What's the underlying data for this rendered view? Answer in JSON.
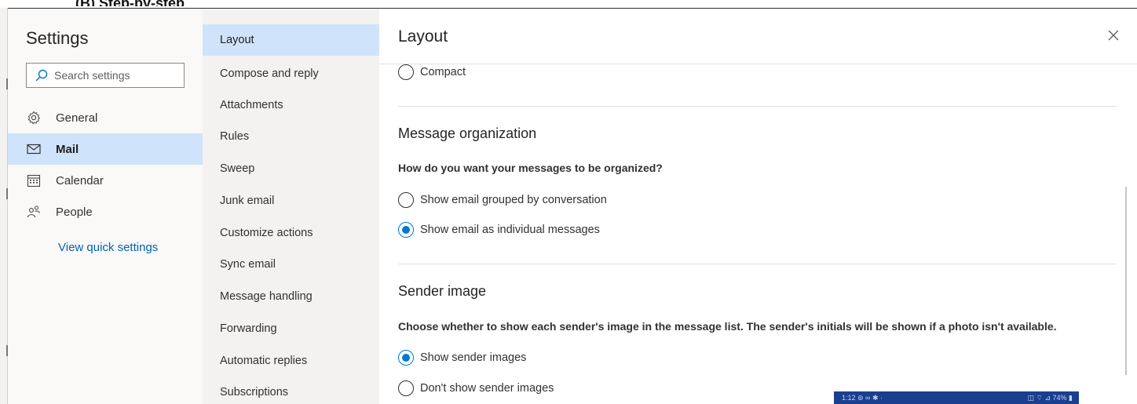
{
  "background": {
    "title_fragment": "(B) Step-by-step"
  },
  "left": {
    "title": "Settings",
    "search_placeholder": "Search settings",
    "categories": [
      {
        "label": "General",
        "icon": "gear-icon"
      },
      {
        "label": "Mail",
        "icon": "mail-icon",
        "active": true
      },
      {
        "label": "Calendar",
        "icon": "calendar-icon"
      },
      {
        "label": "People",
        "icon": "people-icon"
      }
    ],
    "quick_link": "View quick settings"
  },
  "middle": {
    "items": [
      {
        "label": "Layout",
        "active": true
      },
      {
        "label": "Compose and reply"
      },
      {
        "label": "Attachments"
      },
      {
        "label": "Rules"
      },
      {
        "label": "Sweep"
      },
      {
        "label": "Junk email"
      },
      {
        "label": "Customize actions"
      },
      {
        "label": "Sync email"
      },
      {
        "label": "Message handling"
      },
      {
        "label": "Forwarding"
      },
      {
        "label": "Automatic replies"
      },
      {
        "label": "Subscriptions"
      }
    ]
  },
  "right": {
    "title": "Layout",
    "compact_option": {
      "label": "Compact",
      "selected": false
    },
    "message_organization": {
      "heading": "Message organization",
      "question": "How do you want your messages to be organized?",
      "options": [
        {
          "label": "Show email grouped by conversation",
          "selected": false
        },
        {
          "label": "Show email as individual messages",
          "selected": true
        }
      ]
    },
    "sender_image": {
      "heading": "Sender image",
      "question": "Choose whether to show each sender's image in the message list. The sender's initials will be shown if a photo isn't available.",
      "options": [
        {
          "label": "Show sender images",
          "selected": true
        },
        {
          "label": "Don't show sender images",
          "selected": false
        }
      ]
    }
  },
  "phone_overlay": {
    "left_text": "1:12 ⊚ ∞ ✱ ·",
    "right_text": "◫ ⌔ ⊿ 74% ▮"
  },
  "colors": {
    "accent": "#0078d4",
    "selected_bg": "#cfe4fa",
    "link": "#0063b1"
  }
}
